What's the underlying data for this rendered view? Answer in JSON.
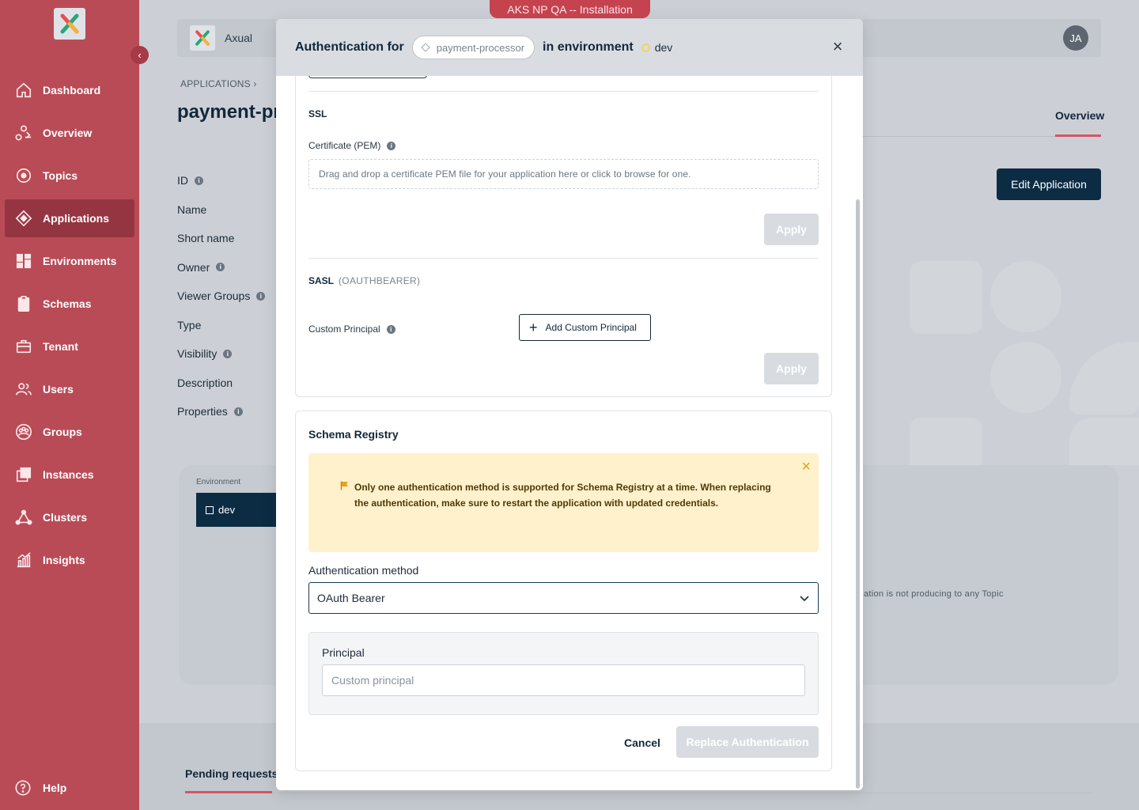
{
  "banner": "AKS NP QA -- Installation",
  "sidebar": {
    "items": [
      {
        "label": "Dashboard",
        "icon": "home-icon"
      },
      {
        "label": "Overview",
        "icon": "overview-icon"
      },
      {
        "label": "Topics",
        "icon": "topics-icon"
      },
      {
        "label": "Applications",
        "icon": "applications-icon",
        "active": true
      },
      {
        "label": "Environments",
        "icon": "environments-icon"
      },
      {
        "label": "Schemas",
        "icon": "schemas-icon"
      },
      {
        "label": "Tenant",
        "icon": "tenant-icon"
      },
      {
        "label": "Users",
        "icon": "users-icon"
      },
      {
        "label": "Groups",
        "icon": "groups-icon"
      },
      {
        "label": "Instances",
        "icon": "instances-icon"
      },
      {
        "label": "Clusters",
        "icon": "clusters-icon"
      },
      {
        "label": "Insights",
        "icon": "insights-icon"
      }
    ],
    "help": "Help"
  },
  "topbar": {
    "brand": "Axual",
    "avatar": "JA"
  },
  "page": {
    "breadcrumb": "APPLICATIONS",
    "title": "payment-processor",
    "tab_overview": "Overview",
    "edit_button": "Edit Application",
    "fields": [
      "ID",
      "Name",
      "Short name",
      "Owner",
      "Viewer Groups",
      "Type",
      "Visibility",
      "Description",
      "Properties"
    ],
    "environment_label": "Environment",
    "environment_value": "dev",
    "not_producing": "ation is not producing to any Topic",
    "pending_tab": "Pending requests"
  },
  "modal": {
    "title_prefix": "Authentication for",
    "app_name": "payment-processor",
    "title_middle": "in environment",
    "env_name": "dev",
    "ssl": {
      "title": "SSL",
      "cert_label": "Certificate (PEM)",
      "dropzone": "Drag and drop a certificate PEM file for your application here or click to browse for one.",
      "apply": "Apply"
    },
    "sasl": {
      "title": "SASL",
      "mechanism": "(OAUTHBEARER)",
      "principal_label": "Custom Principal",
      "add_button": "Add Custom Principal",
      "apply": "Apply"
    },
    "schema_registry": {
      "title": "Schema Registry",
      "warning": "Only one authentication method is supported for Schema Registry at a time. When replacing the authentication, make sure to restart the application with updated credentials.",
      "auth_label": "Authentication method",
      "auth_value": "OAuth Bearer",
      "principal_label": "Principal",
      "principal_placeholder": "Custom principal",
      "cancel": "Cancel",
      "replace": "Replace Authentication"
    }
  },
  "colors": {
    "sidebar": "#b94b56",
    "accent": "#0c2c44",
    "warning_bg": "#fff1cc"
  }
}
